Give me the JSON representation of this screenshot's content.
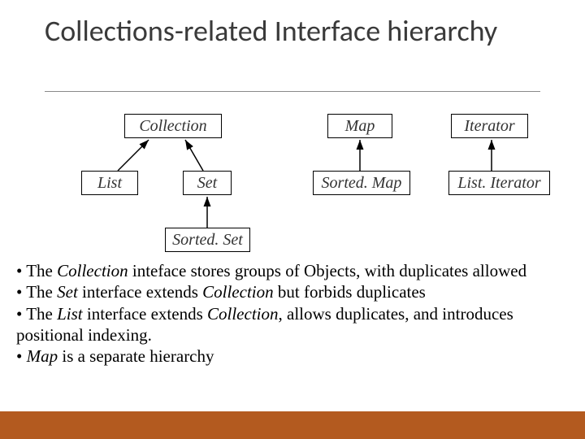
{
  "title": "Collections-related Interface hierarchy",
  "nodes": {
    "collection": "Collection",
    "map": "Map",
    "iterator": "Iterator",
    "list": "List",
    "set": "Set",
    "sortedmap": "Sorted. Map",
    "listiterator": "List. Iterator",
    "sortedset": "Sorted. Set"
  },
  "bullets": {
    "b1_pre": "• The ",
    "b1_em": "Collection",
    "b1_post": " inteface stores groups of Objects, with duplicates allowed",
    "b2_pre": " • The ",
    "b2_em1": "Set",
    "b2_mid": " interface extends ",
    "b2_em2": "Collection",
    "b2_post": " but forbids duplicates",
    "b3_pre": " • The ",
    "b3_em1": "List",
    "b3_mid": " interface extends ",
    "b3_em2": "Collection",
    "b3_post": ", allows duplicates, and introduces positional indexing.",
    "b4_pre": " • ",
    "b4_em": "Map",
    "b4_post": " is a separate hierarchy"
  }
}
